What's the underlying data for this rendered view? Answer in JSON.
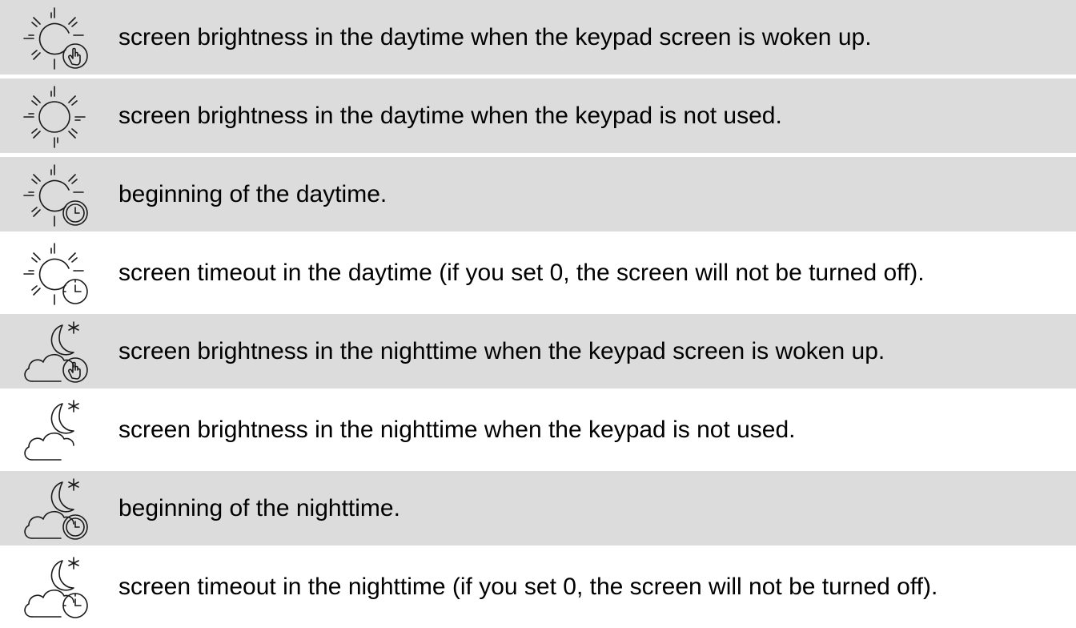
{
  "rows": [
    {
      "icon": "sun-hand-icon",
      "text": "screen brightness in the daytime when the keypad screen is woken up."
    },
    {
      "icon": "sun-icon",
      "text": "screen brightness in the daytime when the keypad is not used."
    },
    {
      "icon": "sun-clock-icon",
      "text": "beginning of the daytime."
    },
    {
      "icon": "sun-timer-icon",
      "text": "screen timeout in the daytime (if you set 0, the screen will not be turned off)."
    },
    {
      "icon": "moon-cloud-hand-icon",
      "text": "screen brightness in the nighttime when the keypad screen is woken up."
    },
    {
      "icon": "moon-cloud-icon",
      "text": "screen brightness in the nighttime when the keypad is not used."
    },
    {
      "icon": "moon-cloud-clock-icon",
      "text": "beginning of the nighttime."
    },
    {
      "icon": "moon-cloud-timer-icon",
      "text": "screen timeout in the nighttime (if you set 0, the screen will not be turned off)."
    }
  ],
  "colors": {
    "shaded_row": "#dcdcdc",
    "plain_row": "#ffffff",
    "text": "#000000",
    "icon_stroke": "#1a1a1a"
  }
}
